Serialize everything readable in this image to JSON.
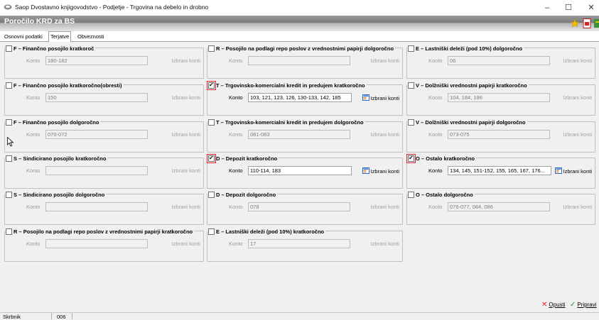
{
  "window": {
    "title": "Saop Dvostavno knjigovodstvo - Podjetje - Trgovina na debelo in drobno",
    "minimize": "–",
    "maximize": "☐",
    "close": "✕"
  },
  "header": {
    "title": "Poročilo KRD za BS"
  },
  "tabs": [
    {
      "label": "Osnovni podatki"
    },
    {
      "label": "Terjatve"
    },
    {
      "label": "Obveznosti"
    }
  ],
  "groups": {
    "c1r1": {
      "label": "F – Finančno posojilo kratkoroč",
      "checked": false,
      "konto_label": "Konto",
      "value": "180-182",
      "izbrani": "Izbrani konti"
    },
    "c1r2": {
      "label": "F – Finančno posojilo kratkoročno(obresti)",
      "checked": false,
      "konto_label": "Konto",
      "value": "150",
      "izbrani": "Izbrani konti"
    },
    "c1r3": {
      "label": "F – Finančno posojilo dolgoročno",
      "checked": false,
      "konto_label": "Konto",
      "value": "070-072",
      "izbrani": "Izbrani konti"
    },
    "c1r4": {
      "label": "S – Sindicirano posojilo kratkoročno",
      "checked": false,
      "konto_label": "Konto",
      "value": "",
      "izbrani": "Izbrani konti"
    },
    "c1r5": {
      "label": "S – Sindicirano posojilo dolgoročno",
      "checked": false,
      "konto_label": "Konto",
      "value": "",
      "izbrani": "Izbrani konti"
    },
    "c1r6": {
      "label": "R – Posojilo na podlagi repo poslov z vrednostnimi papirji kratkoročno",
      "checked": false,
      "konto_label": "Konto",
      "value": "",
      "izbrani": "Izbrani konti"
    },
    "c2r1": {
      "label": "R – Posojilo na podlagi repo poslov z vrednostnimi papirji dolgoročno",
      "checked": false,
      "konto_label": "Konto",
      "value": "",
      "izbrani": "Izbrani konti"
    },
    "c2r2": {
      "label": "T – Trgovinsko-komercialni kredit in predujem kratkoročno",
      "checked": true,
      "konto_label": "Konto",
      "value": "103, 121, 123, 126, 130-133, 142, 185",
      "izbrani": "Izbrani konti"
    },
    "c2r3": {
      "label": "T – Trgovinsko-komercialni kredit in predujem dolgoročno",
      "checked": false,
      "konto_label": "Konto",
      "value": "081-083",
      "izbrani": "Izbrani konti"
    },
    "c2r4": {
      "label": "D – Depozit kratkoročno",
      "checked": true,
      "konto_label": "Konto",
      "value": "110-114, 183",
      "izbrani": "Izbrani konti"
    },
    "c2r5": {
      "label": "D – Depozit dolgoročno",
      "checked": false,
      "konto_label": "Konto",
      "value": "078",
      "izbrani": "Izbrani konti"
    },
    "c2r6": {
      "label": "E – Lastniški deleži (pod 10%) kratkoročno",
      "checked": false,
      "konto_label": "Konto",
      "value": "17",
      "izbrani": "Izbrani konti"
    },
    "c3r1": {
      "label": "E – Lastniški deleži (pod 10%) dolgoročno",
      "checked": false,
      "konto_label": "Konto",
      "value": "06",
      "izbrani": "Izbrani konti"
    },
    "c3r2": {
      "label": "V – Dolžniški vrednostni papirji kratkoročno",
      "checked": false,
      "konto_label": "Konto",
      "value": "104, 184, 186",
      "izbrani": "Izbrani konti"
    },
    "c3r3": {
      "label": "V – Dolžniški vrednostni papirji dolgoročno",
      "checked": false,
      "konto_label": "Konto",
      "value": "073-075",
      "izbrani": "Izbrani konti"
    },
    "c3r4": {
      "label": "O – Ostalo kratkoročno",
      "checked": true,
      "konto_label": "Konto",
      "value": "134, 145, 151-152, 155, 165, 167, 176...",
      "izbrani": "Izbrani konti"
    },
    "c3r5": {
      "label": "O – Ostalo dolgoročno",
      "checked": false,
      "konto_label": "Konto",
      "value": "076-077, 084, 086",
      "izbrani": "Izbrani konti"
    }
  },
  "footer": {
    "opusti": "Opusti",
    "pripravi": "Pripravi"
  },
  "status": {
    "user": "Skrbnik",
    "code": "006"
  },
  "colors": {
    "accent_red": "#e4232d",
    "header_gray": "#8a8a8a",
    "ok_green": "#2a9a2a"
  }
}
